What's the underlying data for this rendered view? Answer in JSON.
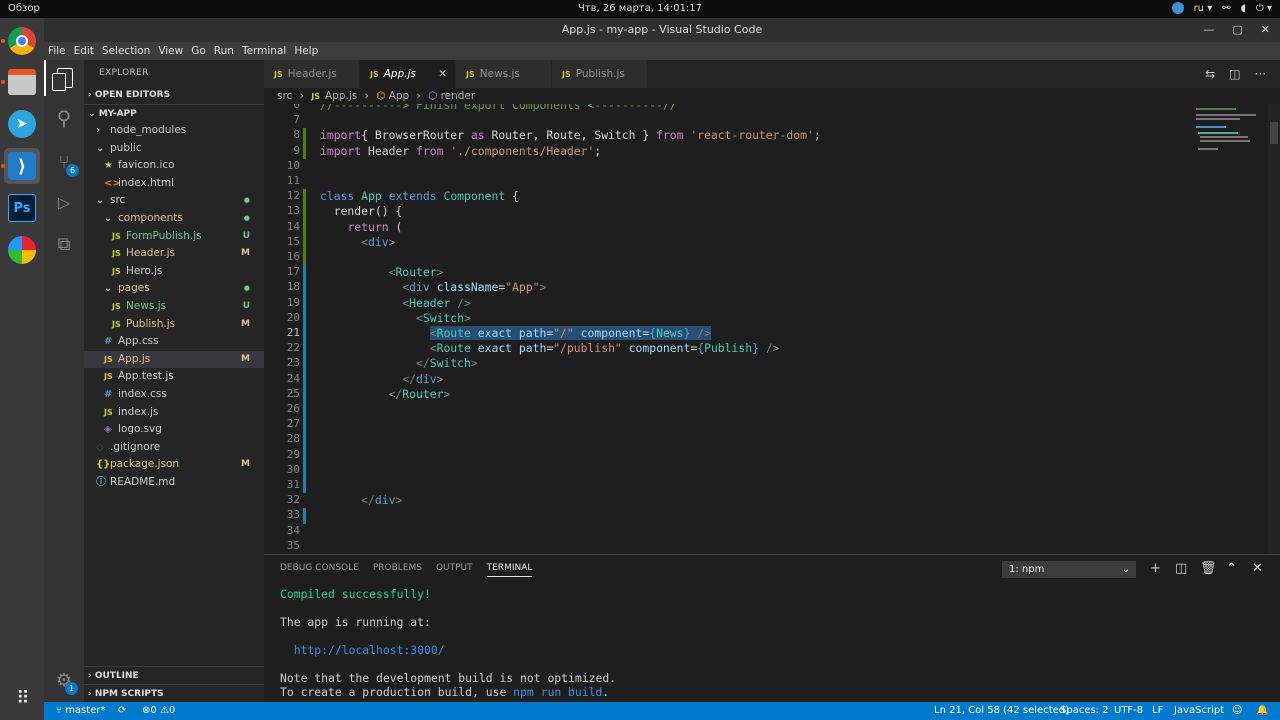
{
  "os": {
    "activities": "Обзор",
    "clock": "Чтв, 26 марта, 14:01:17",
    "lang": "ru"
  },
  "window": {
    "title": "App.js - my-app - Visual Studio Code"
  },
  "menu": [
    "File",
    "Edit",
    "Selection",
    "View",
    "Go",
    "Run",
    "Terminal",
    "Help"
  ],
  "activity_badges": {
    "scm": "6",
    "settings": "1"
  },
  "sidebar": {
    "title": "EXPLORER",
    "open_editors": "OPEN EDITORS",
    "project": "MY-APP",
    "outline": "OUTLINE",
    "npm_scripts": "NPM SCRIPTS",
    "files": [
      {
        "name": "node_modules",
        "icon": "›",
        "indent": 1,
        "type": "folder"
      },
      {
        "name": "public",
        "icon": "⌄",
        "indent": 1,
        "type": "folder"
      },
      {
        "name": "favicon.ico",
        "icon": "★",
        "indent": 2,
        "type": "file",
        "color": "#cbcb41"
      },
      {
        "name": "index.html",
        "icon": "<>",
        "indent": 2,
        "type": "file",
        "color": "#e37933"
      },
      {
        "name": "src",
        "icon": "⌄",
        "indent": 1,
        "type": "folder",
        "status": "●",
        "statusColor": "#73c991"
      },
      {
        "name": "components",
        "icon": "⌄",
        "indent": 2,
        "type": "folder",
        "status": "●",
        "statusColor": "#73c991",
        "textColor": "#e2c08d"
      },
      {
        "name": "FormPublish.js",
        "icon": "JS",
        "indent": 3,
        "type": "file",
        "status": "U",
        "statusColor": "#73c991",
        "textColor": "#73c991",
        "color": "#cbcb41"
      },
      {
        "name": "Header.js",
        "icon": "JS",
        "indent": 3,
        "type": "file",
        "status": "M",
        "statusColor": "#e2c08d",
        "textColor": "#e2c08d",
        "color": "#cbcb41"
      },
      {
        "name": "Hero.js",
        "icon": "JS",
        "indent": 3,
        "type": "file",
        "color": "#cbcb41"
      },
      {
        "name": "pages",
        "icon": "⌄",
        "indent": 2,
        "type": "folder",
        "status": "●",
        "statusColor": "#73c991",
        "textColor": "#e2c08d"
      },
      {
        "name": "News.js",
        "icon": "JS",
        "indent": 3,
        "type": "file",
        "status": "U",
        "statusColor": "#73c991",
        "textColor": "#73c991",
        "color": "#cbcb41"
      },
      {
        "name": "Publish.js",
        "icon": "JS",
        "indent": 3,
        "type": "file",
        "status": "M",
        "statusColor": "#e2c08d",
        "textColor": "#e2c08d",
        "color": "#cbcb41"
      },
      {
        "name": "App.css",
        "icon": "#",
        "indent": 2,
        "type": "file",
        "color": "#519aba"
      },
      {
        "name": "App.js",
        "icon": "JS",
        "indent": 2,
        "type": "file",
        "status": "M",
        "statusColor": "#e2c08d",
        "textColor": "#e2c08d",
        "color": "#cbcb41",
        "selected": true
      },
      {
        "name": "App.test.js",
        "icon": "JS",
        "indent": 2,
        "type": "file",
        "color": "#cbcb41"
      },
      {
        "name": "index.css",
        "icon": "#",
        "indent": 2,
        "type": "file",
        "color": "#519aba"
      },
      {
        "name": "index.js",
        "icon": "JS",
        "indent": 2,
        "type": "file",
        "color": "#cbcb41"
      },
      {
        "name": "logo.svg",
        "icon": "◈",
        "indent": 2,
        "type": "file",
        "color": "#a074c4"
      },
      {
        "name": ".gitignore",
        "icon": "◇",
        "indent": 1,
        "type": "file",
        "color": "#41535b"
      },
      {
        "name": "package.json",
        "icon": "{}",
        "indent": 1,
        "type": "file",
        "status": "M",
        "statusColor": "#e2c08d",
        "textColor": "#e2c08d",
        "color": "#cbcb41"
      },
      {
        "name": "README.md",
        "icon": "ⓘ",
        "indent": 1,
        "type": "file",
        "color": "#519aba"
      }
    ]
  },
  "tabs": [
    {
      "label": "Header.js",
      "active": false
    },
    {
      "label": "App.js",
      "active": true
    },
    {
      "label": "News.js",
      "active": false
    },
    {
      "label": "Publish.js",
      "active": false
    }
  ],
  "breadcrumb": [
    "src",
    "App.js",
    "App",
    "render"
  ],
  "code": [
    {
      "n": "6",
      "t": [
        [
          "cm",
          "//----------> Finish export Components <----------//"
        ]
      ]
    },
    {
      "n": "7",
      "t": []
    },
    {
      "n": "8",
      "t": [
        [
          "kc",
          "import"
        ],
        [
          "",
          "{ BrowserRouter "
        ],
        [
          "kc",
          "as"
        ],
        [
          "",
          " Router, Route, Switch } "
        ],
        [
          "kc",
          "from"
        ],
        [
          "",
          " "
        ],
        [
          "str",
          "'react-router-dom'"
        ],
        [
          "",
          ";"
        ]
      ]
    },
    {
      "n": "9",
      "t": [
        [
          "kc",
          "import"
        ],
        [
          "",
          " Header "
        ],
        [
          "kc",
          "from"
        ],
        [
          "",
          " "
        ],
        [
          "str",
          "'./components/Header'"
        ],
        [
          "",
          ";"
        ]
      ]
    },
    {
      "n": "10",
      "t": []
    },
    {
      "n": "11",
      "t": []
    },
    {
      "n": "12",
      "t": [
        [
          "kw",
          "class"
        ],
        [
          "",
          " "
        ],
        [
          "cls",
          "App"
        ],
        [
          "",
          " "
        ],
        [
          "kw",
          "extends"
        ],
        [
          "",
          " "
        ],
        [
          "cls",
          "Component"
        ],
        [
          "",
          " {"
        ]
      ]
    },
    {
      "n": "13",
      "t": [
        [
          "",
          "  render() {"
        ]
      ]
    },
    {
      "n": "14",
      "t": [
        [
          "",
          "    "
        ],
        [
          "kc",
          "return"
        ],
        [
          "",
          " ("
        ]
      ]
    },
    {
      "n": "15",
      "t": [
        [
          "",
          "      "
        ],
        [
          "tg",
          "<"
        ],
        [
          "kw",
          "div"
        ],
        [
          "tg",
          ">"
        ]
      ]
    },
    {
      "n": "16",
      "t": []
    },
    {
      "n": "17",
      "t": [
        [
          "",
          "          "
        ],
        [
          "tg",
          "<"
        ],
        [
          "cls",
          "Router"
        ],
        [
          "tg",
          ">"
        ]
      ]
    },
    {
      "n": "18",
      "t": [
        [
          "",
          "            "
        ],
        [
          "tg",
          "<"
        ],
        [
          "kw",
          "div"
        ],
        [
          "",
          " "
        ],
        [
          "at",
          "className"
        ],
        [
          "",
          "="
        ],
        [
          "str",
          "\"App\""
        ],
        [
          "tg",
          ">"
        ]
      ]
    },
    {
      "n": "19",
      "t": [
        [
          "",
          "            "
        ],
        [
          "tg",
          "<"
        ],
        [
          "cls",
          "Header"
        ],
        [
          "",
          " "
        ],
        [
          "tg",
          "/>"
        ]
      ]
    },
    {
      "n": "20",
      "t": [
        [
          "",
          "              "
        ],
        [
          "tg",
          "<"
        ],
        [
          "cls",
          "Switch"
        ],
        [
          "tg",
          ">"
        ]
      ]
    },
    {
      "n": "21",
      "t": [
        [
          "",
          "                "
        ],
        [
          "tg",
          "<"
        ],
        [
          "cls",
          "Route"
        ],
        [
          "",
          " "
        ],
        [
          "at",
          "exact"
        ],
        [
          "",
          " "
        ],
        [
          "at",
          "path"
        ],
        [
          "",
          "="
        ],
        [
          "str",
          "\"/\""
        ],
        [
          "",
          " "
        ],
        [
          "at",
          "component"
        ],
        [
          "",
          "="
        ],
        [
          "kw",
          "{"
        ],
        [
          "cls",
          "News"
        ],
        [
          "kw",
          "}"
        ],
        [
          "",
          " "
        ],
        [
          "tg",
          "/>"
        ]
      ],
      "hl": true
    },
    {
      "n": "22",
      "t": [
        [
          "",
          "                "
        ],
        [
          "tg",
          "<"
        ],
        [
          "cls",
          "Route"
        ],
        [
          "",
          " "
        ],
        [
          "at",
          "exact"
        ],
        [
          "",
          " "
        ],
        [
          "at",
          "path"
        ],
        [
          "",
          "="
        ],
        [
          "str",
          "\"/publish\""
        ],
        [
          "",
          " "
        ],
        [
          "at",
          "component"
        ],
        [
          "",
          "="
        ],
        [
          "kw",
          "{"
        ],
        [
          "cls",
          "Publish"
        ],
        [
          "kw",
          "}"
        ],
        [
          "",
          " "
        ],
        [
          "tg",
          "/>"
        ]
      ]
    },
    {
      "n": "23",
      "t": [
        [
          "",
          "              "
        ],
        [
          "tg",
          "</"
        ],
        [
          "cls",
          "Switch"
        ],
        [
          "tg",
          ">"
        ]
      ]
    },
    {
      "n": "24",
      "t": [
        [
          "",
          "            "
        ],
        [
          "tg",
          "</"
        ],
        [
          "kw",
          "div"
        ],
        [
          "tg",
          ">"
        ]
      ]
    },
    {
      "n": "25",
      "t": [
        [
          "",
          "          "
        ],
        [
          "tg",
          "</"
        ],
        [
          "cls",
          "Router"
        ],
        [
          "tg",
          ">"
        ]
      ]
    },
    {
      "n": "26",
      "t": []
    },
    {
      "n": "27",
      "t": []
    },
    {
      "n": "28",
      "t": []
    },
    {
      "n": "29",
      "t": []
    },
    {
      "n": "30",
      "t": []
    },
    {
      "n": "31",
      "t": []
    },
    {
      "n": "32",
      "t": [
        [
          "",
          "      "
        ],
        [
          "tg",
          "</"
        ],
        [
          "kw",
          "div"
        ],
        [
          "tg",
          ">"
        ]
      ]
    },
    {
      "n": "33",
      "t": []
    },
    {
      "n": "34",
      "t": []
    },
    {
      "n": "35",
      "t": []
    }
  ],
  "panel": {
    "tabs": [
      "DEBUG CONSOLE",
      "PROBLEMS",
      "OUTPUT",
      "TERMINAL"
    ],
    "active_tab": "TERMINAL",
    "terminal_select": "1: npm",
    "lines": [
      {
        "text": "Compiled successfully!",
        "color": "#23d18b"
      },
      {
        "text": "",
        "color": ""
      },
      {
        "text": "The app is running at:",
        "color": ""
      },
      {
        "text": "",
        "color": ""
      },
      {
        "text": "  http://localhost:3000/",
        "color": "#3b8eea"
      },
      {
        "text": "",
        "color": ""
      },
      {
        "text": "Note that the development build is not optimized.",
        "color": ""
      }
    ],
    "last_line_prefix": "To create a production build, use ",
    "last_line_cmd": "npm run build",
    "last_line_suffix": "."
  },
  "status": {
    "branch": "master*",
    "errors": "0",
    "warnings": "0",
    "position": "Ln 21, Col 58 (42 selected)",
    "spaces": "Spaces: 2",
    "encoding": "UTF-8",
    "eol": "LF",
    "language": "JavaScript"
  },
  "colors": {
    "accent": "#007acc",
    "selection": "#264f78",
    "modified": "#e2c08d",
    "untracked": "#73c991"
  }
}
